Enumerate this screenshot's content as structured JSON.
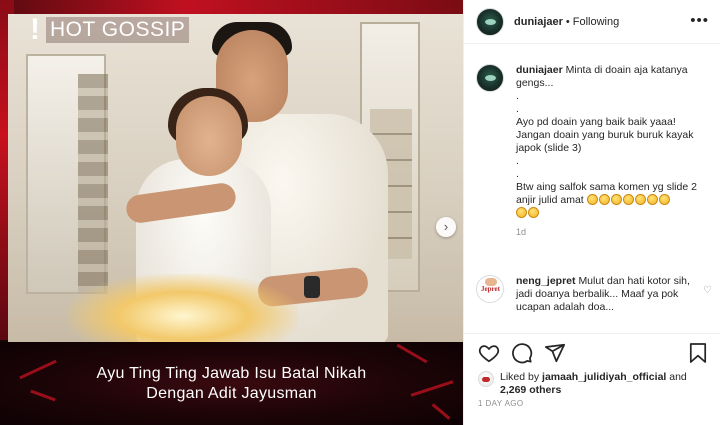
{
  "post": {
    "overlay_label": "HOT GOSSIP",
    "overlay_bang": "!",
    "caption_line1": "Ayu Ting Ting Jawab Isu Batal Nikah",
    "caption_line2": "Dengan Adit Jayusman",
    "next_icon": "chevron-right-icon"
  },
  "header": {
    "username": "duniajaer",
    "separator": "•",
    "follow_status": "Following",
    "more_icon": "ellipsis-icon",
    "more_glyph": "•••"
  },
  "caption_comment": {
    "username": "duniajaer",
    "lines": [
      "Minta di doain aja katanya",
      "gengs...",
      ".",
      ".",
      "Ayo pd doain yang baik baik yaaa!",
      "Jangan doain yang buruk buruk kayak",
      "japok (slide 3)",
      ".",
      ".",
      "Btw aing salfok sama komen yg slide 2",
      "anjir julid amat"
    ],
    "emoji_name": "rolling-on-floor-laughing-emoji",
    "emoji_count_line1": 7,
    "emoji_count_line2": 2,
    "time": "1d"
  },
  "comment": {
    "username": "neng_jepret",
    "text": "Mulut dan hati kotor sih, jadi doanya berbalik... Maaf ya pok ucapan adalah doa...",
    "avatar_text": "Jepret"
  },
  "actions": {
    "like_icon": "heart-icon",
    "comment_icon": "comment-icon",
    "share_icon": "share-icon",
    "save_icon": "bookmark-icon"
  },
  "likes": {
    "prefix": "Liked by",
    "user": "jamaah_julidiyah_official",
    "connector": "and",
    "others": "2,269 others"
  },
  "date": "1 DAY AGO"
}
